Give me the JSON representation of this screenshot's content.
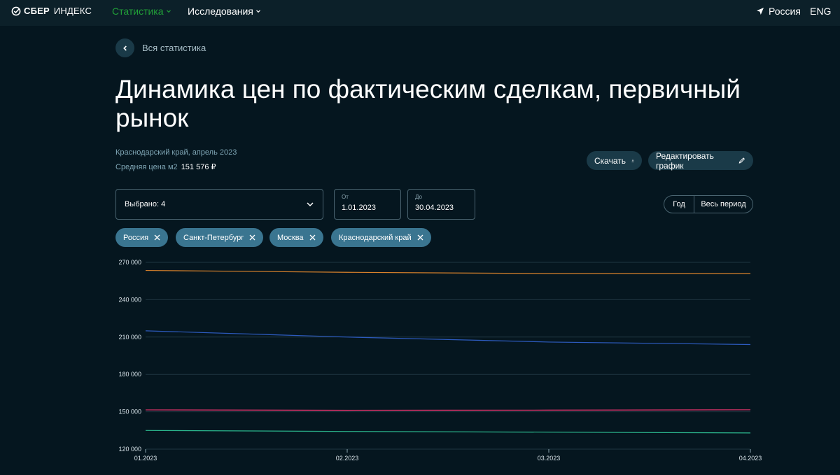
{
  "header": {
    "logo_bold": "СБЕР",
    "logo_light": "ИНДЕКС",
    "nav_statistics": "Статистика",
    "nav_research": "Исследования",
    "region": "Россия",
    "language": "ENG"
  },
  "back": {
    "label": "Вся статистика"
  },
  "page": {
    "title": "Динамика цен по фактическим сделкам, первичный рынок",
    "subtitle": "Краснодарский край, апрель 2023",
    "avg_label": "Средняя цена м2",
    "avg_value": "151 576 ₽"
  },
  "actions": {
    "download": "Скачать",
    "edit": "Редактировать график"
  },
  "filters": {
    "selected": "Выбрано: 4",
    "from_label": "От",
    "from_value": "1.01.2023",
    "to_label": "До",
    "to_value": "30.04.2023",
    "period_year": "Год",
    "period_all": "Весь период"
  },
  "chips": [
    "Россия",
    "Санкт-Петербург",
    "Москва",
    "Краснодарский край"
  ],
  "colors": {
    "accent_green": "#21a038",
    "chip_bg": "#3a7590",
    "series_orange": "#d9822b",
    "series_blue": "#2d5bbf",
    "series_pink": "#e0336b",
    "series_teal": "#2bb58c"
  },
  "chart_data": {
    "type": "line",
    "categories": [
      "01.2023",
      "02.2023",
      "03.2023",
      "04.2023"
    ],
    "ylim": [
      120000,
      270000
    ],
    "yticks": [
      "270 000",
      "240 000",
      "210 000",
      "180 000",
      "150 000",
      "120 000"
    ],
    "ytick_values": [
      270000,
      240000,
      210000,
      180000,
      150000,
      120000
    ],
    "grid": true,
    "series": [
      {
        "color": "#d9822b",
        "values": [
          263500,
          262000,
          261000,
          261000
        ]
      },
      {
        "color": "#2d5bbf",
        "values": [
          215000,
          210000,
          206000,
          204000
        ]
      },
      {
        "color": "#e0336b",
        "values": [
          151500,
          151200,
          151300,
          151576
        ]
      },
      {
        "color": "#2bb58c",
        "values": [
          135000,
          134200,
          133600,
          133000
        ]
      }
    ]
  }
}
